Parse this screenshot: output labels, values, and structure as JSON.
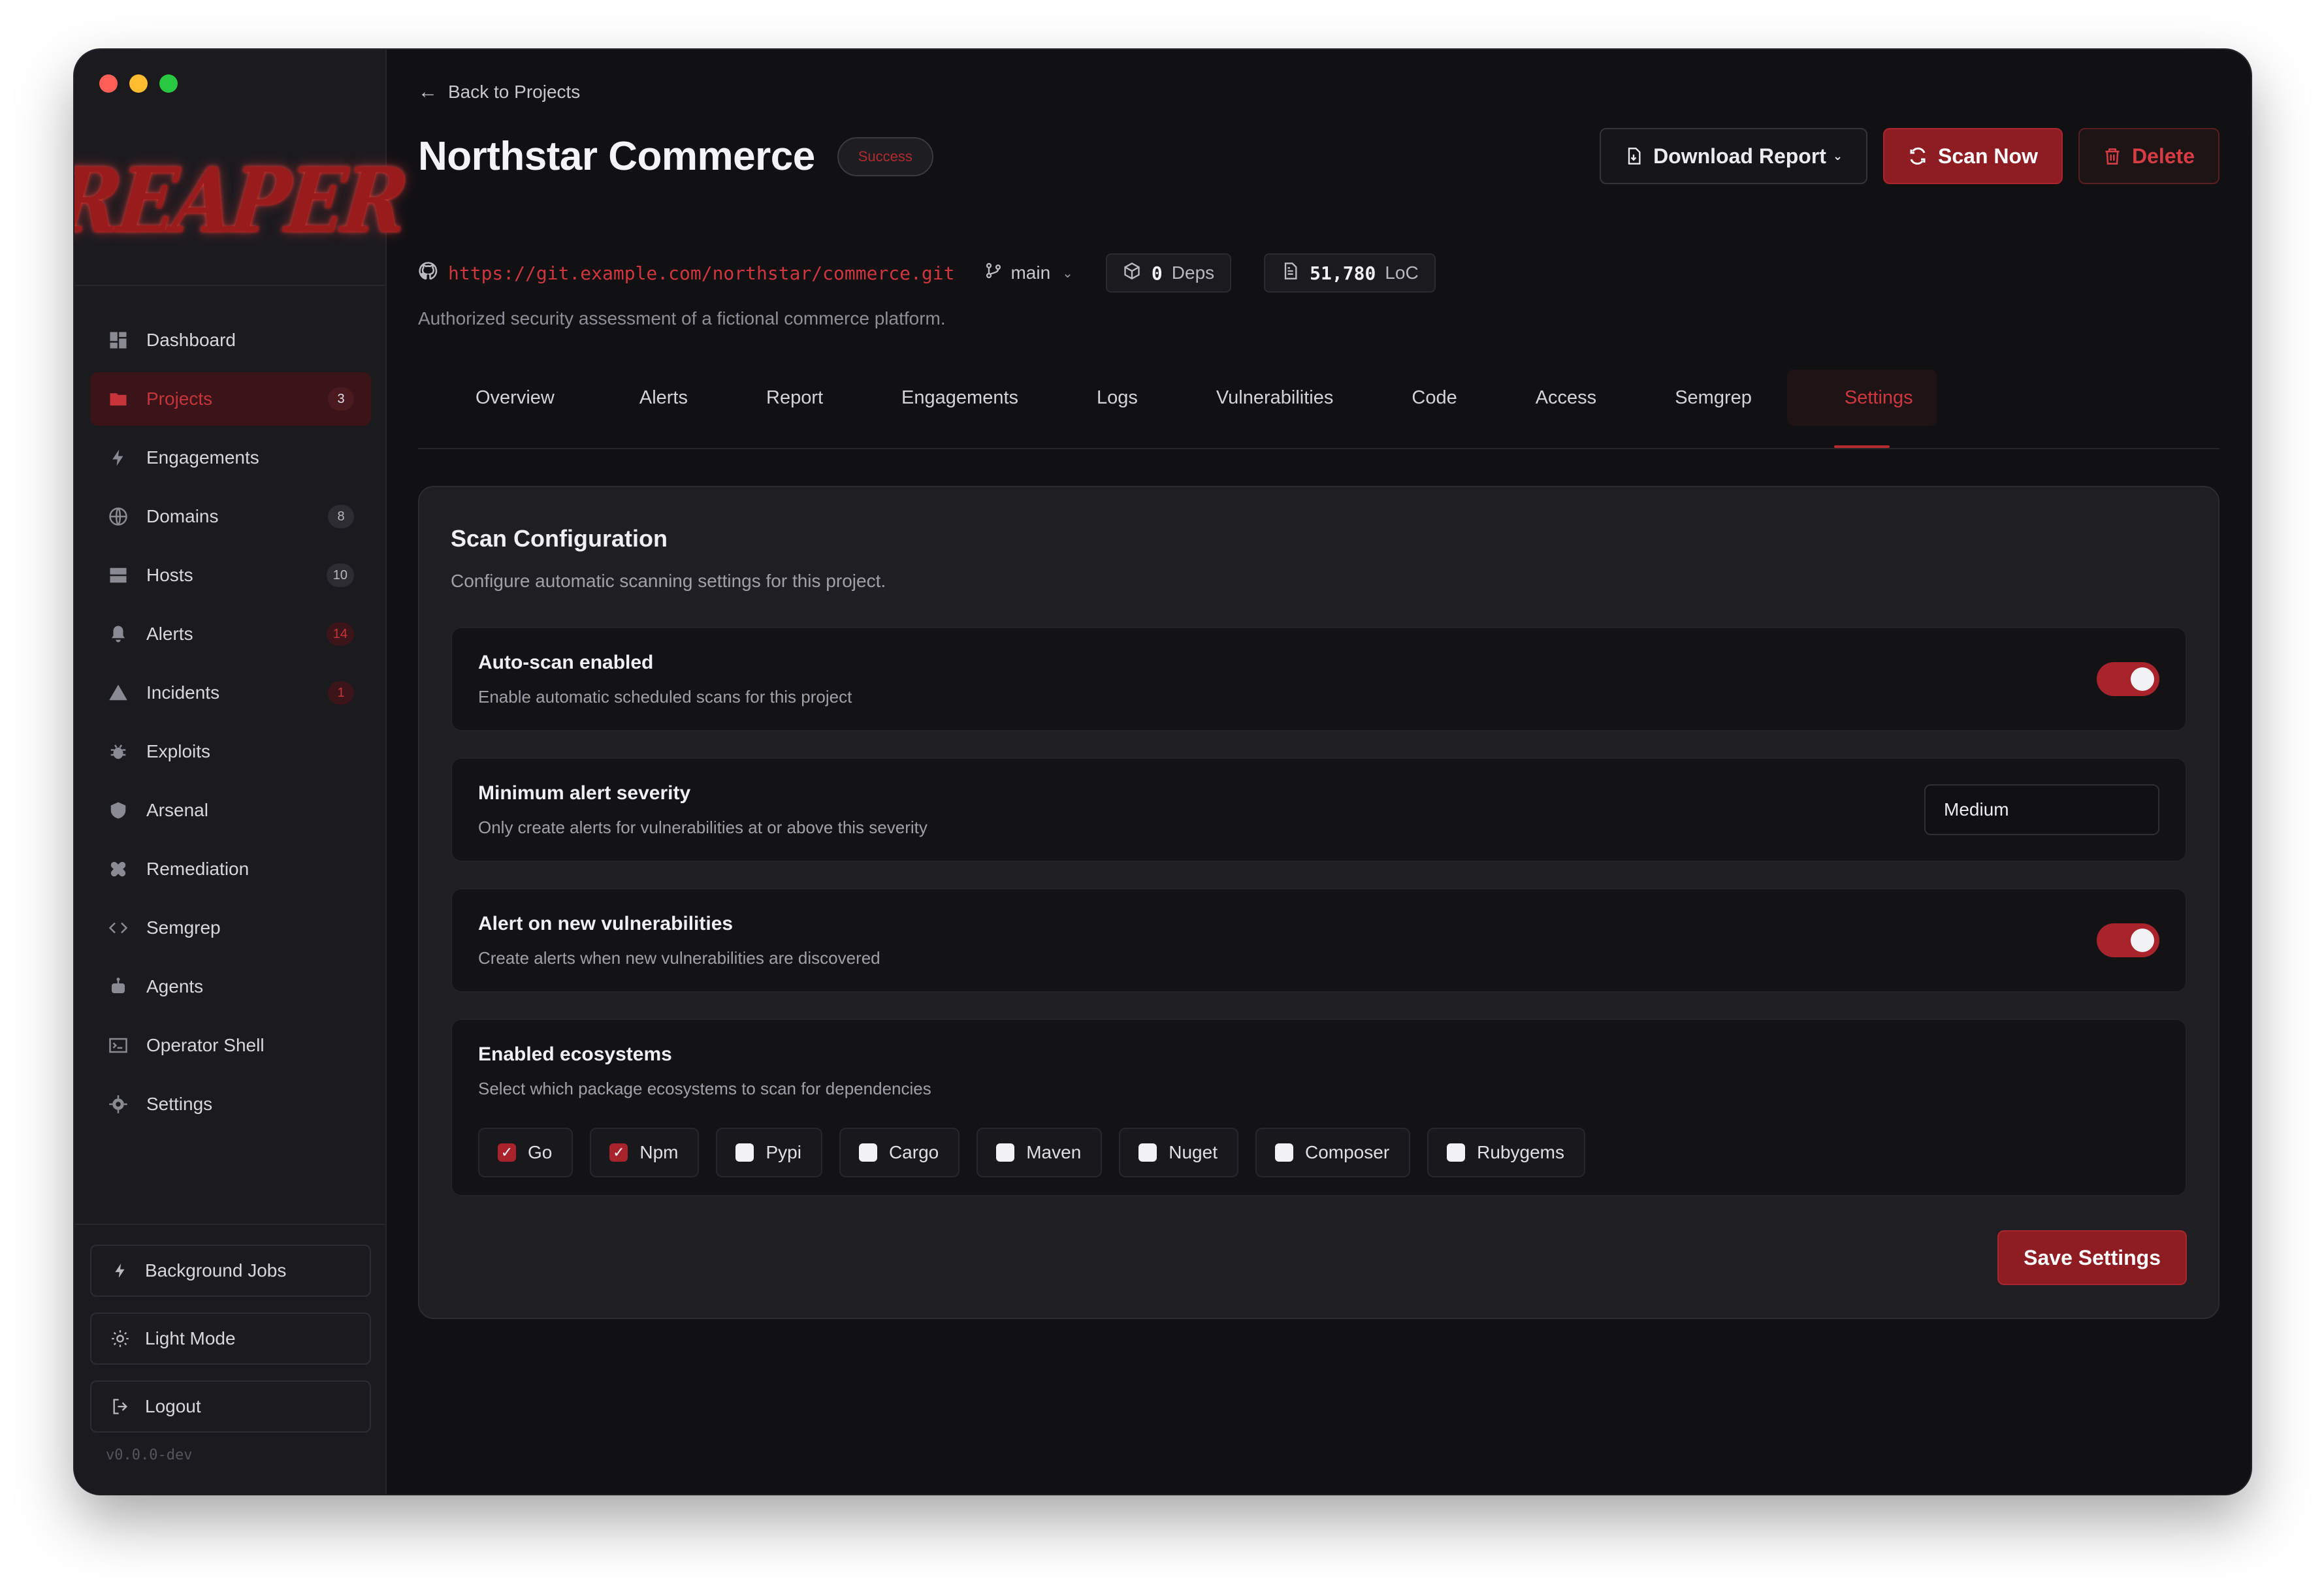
{
  "app": {
    "logo_text": "REAPER",
    "version": "v0.0.0-dev"
  },
  "sidebar": {
    "items": [
      {
        "label": "Dashboard",
        "icon": "dashboard-icon",
        "badge": null,
        "active": false
      },
      {
        "label": "Projects",
        "icon": "folder-icon",
        "badge": "3",
        "active": true
      },
      {
        "label": "Engagements",
        "icon": "bolt-icon",
        "badge": null,
        "active": false
      },
      {
        "label": "Domains",
        "icon": "globe-icon",
        "badge": "8",
        "active": false
      },
      {
        "label": "Hosts",
        "icon": "server-icon",
        "badge": "10",
        "active": false
      },
      {
        "label": "Alerts",
        "icon": "bell-icon",
        "badge": "14",
        "active": false
      },
      {
        "label": "Incidents",
        "icon": "warning-icon",
        "badge": "1",
        "active": false
      },
      {
        "label": "Exploits",
        "icon": "bug-icon",
        "badge": null,
        "active": false
      },
      {
        "label": "Arsenal",
        "icon": "shield-icon",
        "badge": null,
        "active": false
      },
      {
        "label": "Remediation",
        "icon": "bandage-icon",
        "badge": null,
        "active": false
      },
      {
        "label": "Semgrep",
        "icon": "code-icon",
        "badge": null,
        "active": false
      },
      {
        "label": "Agents",
        "icon": "robot-icon",
        "badge": null,
        "active": false
      },
      {
        "label": "Operator Shell",
        "icon": "terminal-icon",
        "badge": null,
        "active": false
      },
      {
        "label": "Settings",
        "icon": "gear-icon",
        "badge": null,
        "active": false
      }
    ],
    "bottom": {
      "background_jobs": "Background Jobs",
      "light_mode": "Light Mode",
      "logout": "Logout"
    }
  },
  "header": {
    "back_label": "Back to Projects",
    "title": "Northstar Commerce",
    "status": "Success",
    "actions": {
      "download": "Download Report",
      "scan": "Scan Now",
      "delete": "Delete"
    },
    "repo_url": "https://git.example.com/northstar/commerce.git",
    "branch": "main",
    "deps_count": "0",
    "deps_label": "Deps",
    "loc_count": "51,780",
    "loc_label": "LoC",
    "description": "Authorized security assessment of a fictional commerce platform."
  },
  "tabs": [
    {
      "label": "Overview",
      "active": false
    },
    {
      "label": "Alerts",
      "active": false
    },
    {
      "label": "Report",
      "active": false
    },
    {
      "label": "Engagements",
      "active": false
    },
    {
      "label": "Logs",
      "active": false
    },
    {
      "label": "Vulnerabilities",
      "active": false
    },
    {
      "label": "Code",
      "active": false
    },
    {
      "label": "Access",
      "active": false
    },
    {
      "label": "Semgrep",
      "active": false
    },
    {
      "label": "Settings",
      "active": true
    }
  ],
  "scan_config": {
    "title": "Scan Configuration",
    "subtitle": "Configure automatic scanning settings for this project.",
    "auto_scan": {
      "title": "Auto-scan enabled",
      "desc": "Enable automatic scheduled scans for this project",
      "enabled": true
    },
    "min_severity": {
      "title": "Minimum alert severity",
      "desc": "Only create alerts for vulnerabilities at or above this severity",
      "value": "Medium"
    },
    "alert_new": {
      "title": "Alert on new vulnerabilities",
      "desc": "Create alerts when new vulnerabilities are discovered",
      "enabled": true
    },
    "ecosystems": {
      "title": "Enabled ecosystems",
      "desc": "Select which package ecosystems to scan for dependencies",
      "items": [
        {
          "label": "Go",
          "checked": true
        },
        {
          "label": "Npm",
          "checked": true
        },
        {
          "label": "Pypi",
          "checked": false
        },
        {
          "label": "Cargo",
          "checked": false
        },
        {
          "label": "Maven",
          "checked": false
        },
        {
          "label": "Nuget",
          "checked": false
        },
        {
          "label": "Composer",
          "checked": false
        },
        {
          "label": "Rubygems",
          "checked": false
        }
      ]
    },
    "save_label": "Save Settings"
  },
  "colors": {
    "accent": "#a8232b",
    "accent_text": "#d0363d",
    "background": "#111114",
    "sidebar": "#1b1b1f"
  }
}
